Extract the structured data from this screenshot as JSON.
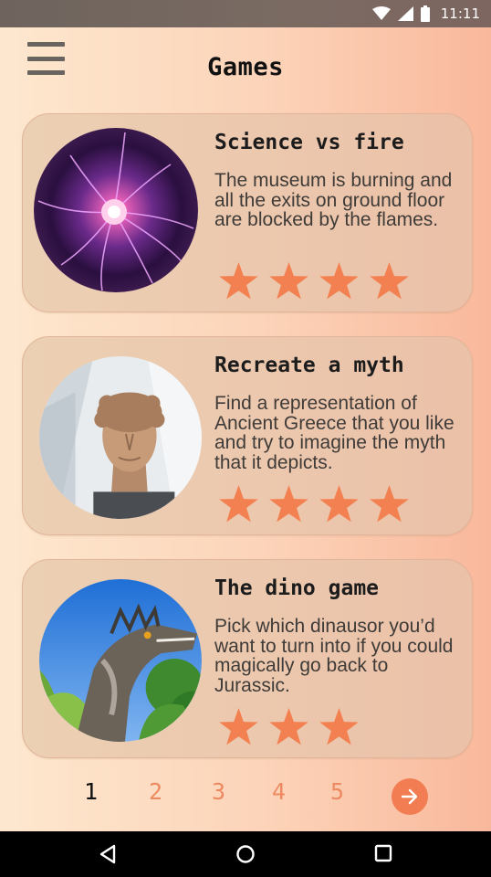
{
  "status_bar": {
    "time": "11:11",
    "icons": [
      "wifi-icon",
      "signal-icon",
      "battery-icon"
    ],
    "color": "#ffffff"
  },
  "header": {
    "title": "Games",
    "menu_icon": "hamburger-menu-icon"
  },
  "games": [
    {
      "title": "Science vs fire",
      "description": "The museum is burning and all the exits on ground floor are blocked by the flames.",
      "image": "plasma-ball-photo",
      "rating": 4
    },
    {
      "title": "Recreate a myth",
      "description": "Find a representation of Ancient Greece that you like and try to imagine the myth that it depicts.",
      "image": "greek-bust-photo",
      "rating": 4
    },
    {
      "title": "The dino game",
      "description": "Pick which dinausor you’d want to turn into if you could magically go back to Jurassic.",
      "image": "dinosaur-photo",
      "rating": 3
    }
  ],
  "pagination": {
    "pages": [
      "1",
      "2",
      "3",
      "4",
      "5"
    ],
    "current": "1",
    "next_icon": "arrow-right-icon"
  },
  "nav_bar": {
    "buttons": [
      "back-icon",
      "home-icon",
      "recents-icon"
    ]
  },
  "colors": {
    "accent": "#f27d52",
    "star": "#f38050",
    "page_number": "#ee8a61"
  }
}
